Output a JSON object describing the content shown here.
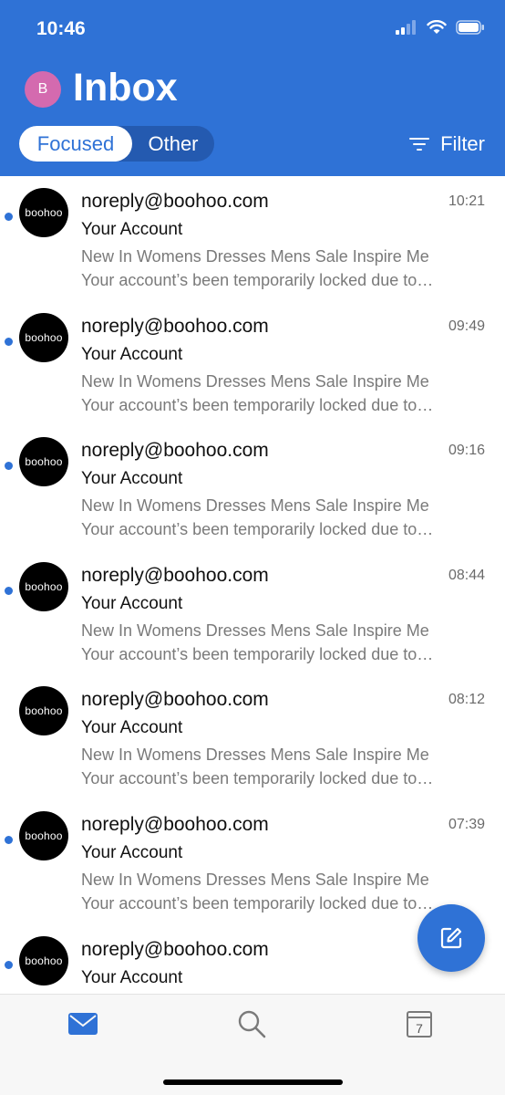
{
  "status_bar": {
    "time": "10:46"
  },
  "header": {
    "avatar_letter": "B",
    "title": "Inbox",
    "tabs": {
      "focused": "Focused",
      "other": "Other",
      "active": "Focused"
    },
    "filter_label": "Filter"
  },
  "emails": [
    {
      "sender": "noreply@boohoo.com",
      "time": "10:21",
      "subject": "Your Account",
      "preview_line1": "New In Womens Dresses Mens Sale Inspire Me",
      "preview_line2": "Your account’s been temporarily locked due to…",
      "unread": true,
      "logo_text": "boohoo"
    },
    {
      "sender": "noreply@boohoo.com",
      "time": "09:49",
      "subject": "Your Account",
      "preview_line1": "New In Womens Dresses Mens Sale Inspire Me",
      "preview_line2": "Your account’s been temporarily locked due to…",
      "unread": true,
      "logo_text": "boohoo"
    },
    {
      "sender": "noreply@boohoo.com",
      "time": "09:16",
      "subject": "Your Account",
      "preview_line1": "New In Womens Dresses Mens Sale Inspire Me",
      "preview_line2": "Your account’s been temporarily locked due to…",
      "unread": true,
      "logo_text": "boohoo"
    },
    {
      "sender": "noreply@boohoo.com",
      "time": "08:44",
      "subject": "Your Account",
      "preview_line1": "New In Womens Dresses Mens Sale Inspire Me",
      "preview_line2": "Your account’s been temporarily locked due to…",
      "unread": true,
      "logo_text": "boohoo"
    },
    {
      "sender": "noreply@boohoo.com",
      "time": "08:12",
      "subject": "Your Account",
      "preview_line1": "New In Womens Dresses Mens Sale Inspire Me",
      "preview_line2": "Your account’s been temporarily locked due to…",
      "unread": false,
      "logo_text": "boohoo"
    },
    {
      "sender": "noreply@boohoo.com",
      "time": "07:39",
      "subject": "Your Account",
      "preview_line1": "New In Womens Dresses Mens Sale Inspire Me",
      "preview_line2": "Your account’s been temporarily locked due to…",
      "unread": true,
      "logo_text": "boohoo"
    },
    {
      "sender": "noreply@boohoo.com",
      "time": "",
      "subject": "Your Account",
      "preview_line1": "",
      "preview_line2": "",
      "unread": true,
      "logo_text": "boohoo"
    }
  ],
  "tab_bar": {
    "items": [
      {
        "icon": "mail-icon",
        "active": true
      },
      {
        "icon": "search-icon",
        "active": false
      },
      {
        "icon": "calendar-icon",
        "active": false,
        "label": "7"
      }
    ]
  },
  "colors": {
    "accent": "#2f72d6",
    "avatar": "#d46aaf",
    "unread_dot": "#2f72d6"
  }
}
